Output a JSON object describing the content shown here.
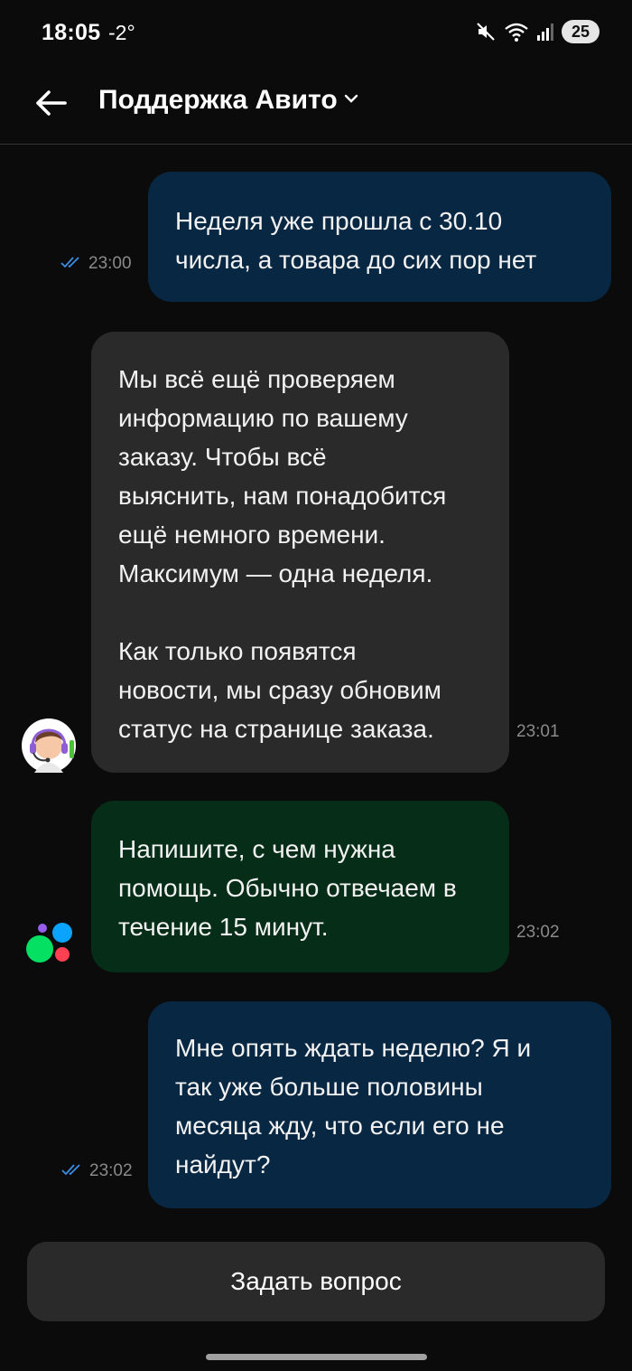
{
  "status_bar": {
    "time": "18:05",
    "temperature": "-2°",
    "battery": "25",
    "icons": [
      "mute-icon",
      "wifi-icon",
      "signal-icon",
      "battery-icon"
    ]
  },
  "header": {
    "back_icon": "arrow-left-icon",
    "title": "Поддержка Авито",
    "dropdown_icon": "chevron-down-icon"
  },
  "messages": [
    {
      "direction": "outgoing",
      "text": "Неделя уже прошла с 30.10\nчисла, а товара до сих пор нет",
      "time": "23:00",
      "read": true
    },
    {
      "direction": "incoming",
      "sender": "support-agent",
      "text": "Мы всё ещё проверяем\nинформацию по вашему\nзаказу. Чтобы всё\nвыяснить, нам понадобится\nещё немного времени.\nМаксимум — одна неделя.\n\nКак только появятся\nновости, мы сразу обновим\nстатус на странице заказа.",
      "time": "23:01"
    },
    {
      "direction": "incoming",
      "sender": "avito-bot",
      "text": "Напишите, с чем нужна\nпомощь. Обычно отвечаем в\nтечение 15 минут.",
      "time": "23:02"
    },
    {
      "direction": "outgoing",
      "text": "Мне опять ждать неделю? Я и\nтак уже больше половины\nмесяца жду, что если его не\nнайдут?",
      "time": "23:02",
      "read": true
    }
  ],
  "footer": {
    "ask_button_label": "Задать вопрос"
  },
  "colors": {
    "background": "#0b0b0b",
    "outgoing_bubble": "#082743",
    "incoming_bubble": "#2a2a2a",
    "bot_bubble": "#062d17",
    "read_ticks": "#3a8ee6"
  }
}
